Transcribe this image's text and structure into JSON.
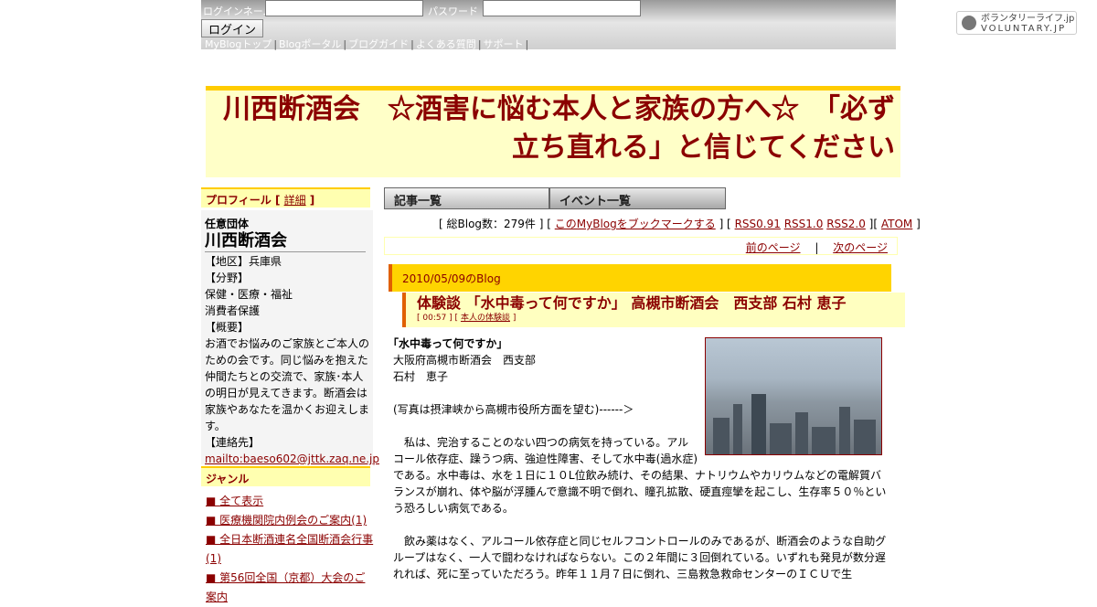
{
  "topbar": {
    "user_label": "ログインネーム",
    "password_label": "パスワード",
    "login_button": "ログイン",
    "nav": [
      "MyBlogトップ",
      "Blogポータル",
      "ブログガイド",
      "よくある質問",
      "サポート"
    ],
    "brand_line1": "ボランタリーライフ.jp",
    "brand_line2": "VOLUNTARY.JP"
  },
  "banner": {
    "title": "川西断酒会　☆酒害に悩む本人と家族の方へ☆　「必ず立ち直れる」と信じてください"
  },
  "sidebar": {
    "profile_heading": "プロフィール",
    "profile_detail_link": "詳細",
    "org_type": "任意団体",
    "org_name": "川西断酒会",
    "region_label": "【地区】兵庫県",
    "field_label": "【分野】",
    "field_1": "保健・医療・福祉",
    "field_2": "消費者保護",
    "summary_label": "【概要】",
    "summary": "お酒でお悩みのご家族とご本人のための会です。同じ悩みを抱えた仲間たちとの交流で、家族･本人の明日が見えてきます。断酒会は家族やあなたを温かくお迎えします。",
    "contact_label": "【連絡先】",
    "contact_email": "mailto:baeso602@jttk.zaq.ne.jp",
    "genre_heading": "ジャンル",
    "genres": [
      "■ 全て表示",
      "■ 医療機関院内例会のご案内(1)",
      "■ 全日本断酒連名全国断酒会行事(1)",
      "■ 第56回全国（京都）大会のご案内"
    ]
  },
  "tabs": {
    "articles": "記事一覧",
    "events": "イベント一覧"
  },
  "stats": {
    "count_text": "[ 総Blog数：279件 ] [",
    "bookmark": "このMyBlogをブックマークする",
    "mid": "] [",
    "rss091": "RSS0.91",
    "rss10": "RSS1.0",
    "rss20": "RSS2.0",
    "mid2": "][",
    "atom": "ATOM",
    "end": "]"
  },
  "pager": {
    "prev": "前のページ",
    "sep": "|",
    "next": "次のページ"
  },
  "post": {
    "date_header": "2010/05/09のBlog",
    "title": "体験談 「水中毒って何ですか」 高槻市断酒会　西支部 石村 恵子",
    "meta_time": "[ 00:57 ] [",
    "meta_category": "本人の体験談",
    "meta_end": "]",
    "heading": "｢水中毒って何ですか｣",
    "line1": "大阪府高槻市断酒会　西支部",
    "line2": "石村　恵子",
    "caption": "(写真は摂津峡から高槻市役所方面を望む)------＞",
    "para1": "　私は、完治することのない四つの病気を持っている。アルコール依存症、躁うつ病、強迫性障害、そして水中毒(過水症)である。水中毒は、水を１日に１０L位飲み続け、その結果、ナトリウムやカリウムなどの電解質バランスが崩れ、体や脳が浮腫んで意識不明で倒れ、瞳孔拡散、硬直痙攣を起こし、生存率５０％という恐ろしい病気である。",
    "para2": "　飲み薬はなく、アルコール依存症と同じセルフコントロールのみであるが、断酒会のような自助グループはなく、一人で闘わなければならない。この２年間に３回倒れている。いずれも発見が数分遅れれば、死に至っていただろう。昨年１１月７日に倒れ、三島救急救命センターのＩＣＵで生"
  },
  "colors": {
    "accent": "#8b0000",
    "banner_bg": "#ffffc8",
    "gold": "#ffd400",
    "orange": "#e06000"
  }
}
